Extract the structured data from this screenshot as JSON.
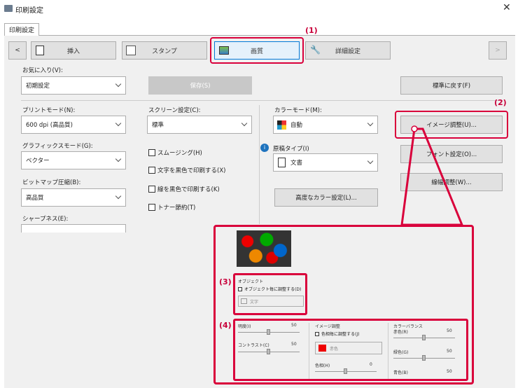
{
  "window": {
    "title": "印刷設定",
    "close": "✕"
  },
  "tab": {
    "label": "印刷設定"
  },
  "nav": {
    "prev": "<",
    "next": ">",
    "tabs": [
      {
        "label": "挿入"
      },
      {
        "label": "スタンプ"
      },
      {
        "label": "画質"
      },
      {
        "label": "詳細設定"
      }
    ]
  },
  "favorites": {
    "label": "お気に入り(V):",
    "value": "初期設定",
    "save": "保存(S)",
    "reset": "標準に戻す(F)"
  },
  "print_mode": {
    "label": "プリントモード(N):",
    "value": "600 dpi (高品質)"
  },
  "screen": {
    "label": "スクリーン設定(C):",
    "value": "標準"
  },
  "color_mode": {
    "label": "カラーモード(M):",
    "value": "自動"
  },
  "graphics": {
    "label": "グラフィックスモード(G):",
    "value": "ベクター"
  },
  "smoothing": "スムージング(H)",
  "text_black": "文字を黒色で印刷する(X)",
  "line_black": "線を黒色で印刷する(K)",
  "toner": "トナー節約(T)",
  "doc_type": {
    "label": "原稿タイプ(I)",
    "value": "文書"
  },
  "bitmap": {
    "label": "ビットマップ圧縮(B):",
    "value": "高品質"
  },
  "sharpness": {
    "label": "シャープネス(E):"
  },
  "advanced_color": "高度なカラー設定(L)...",
  "image_adjust": "イメージ調整(U)...",
  "font_settings": "フォント設定(O)...",
  "line_width": "線幅調整(W)...",
  "callouts": {
    "c1": "(1)",
    "c2": "(2)",
    "c3": "(3)",
    "c4": "(4)"
  },
  "zoom": {
    "object_title": "オブジェクト",
    "object_cb": "オブジェクト毎に調整する(D)",
    "object_sel": "文字",
    "brightness": "明度(I)",
    "brightness_val": "50",
    "contrast": "コントラスト(C)",
    "contrast_val": "50",
    "image_adj": "イメージ調整",
    "per_color_cb": "色相毎に調整する(J)",
    "color_sel": "赤色",
    "hue": "色相(H)",
    "hue_val": "0",
    "balance": "カラーバランス",
    "red": "赤色(R)",
    "red_val": "50",
    "green": "緑色(G)",
    "green_val": "50",
    "blue": "青色(B)",
    "blue_val": "50",
    "lt": "<",
    "gt": ">"
  },
  "colors": {
    "accent": "#d9003b"
  }
}
